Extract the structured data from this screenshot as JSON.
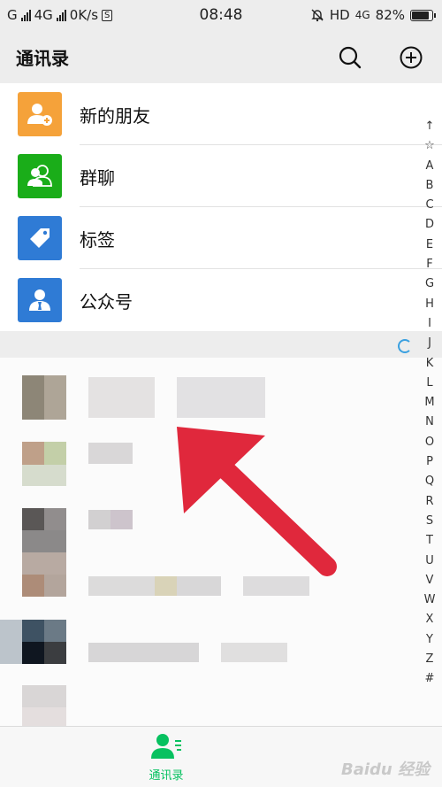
{
  "status_bar": {
    "left": "G",
    "network": "4G",
    "speed": "0K/s",
    "sim_box": "S",
    "time": "08:48",
    "hd": "HD",
    "network2": "4G",
    "battery": "82%"
  },
  "header": {
    "title": "通讯录"
  },
  "functions": [
    {
      "label": "新的朋友",
      "color": "#f5a23a",
      "icon": "add-friend-icon"
    },
    {
      "label": "群聊",
      "color": "#1aad19",
      "icon": "group-chat-icon"
    },
    {
      "label": "标签",
      "color": "#2f7bd5",
      "icon": "tag-icon"
    },
    {
      "label": "公众号",
      "color": "#2f7bd5",
      "icon": "official-account-icon"
    }
  ],
  "alphabet": [
    "↑",
    "☆",
    "A",
    "B",
    "C",
    "D",
    "E",
    "F",
    "G",
    "H",
    "I",
    "J",
    "K",
    "L",
    "M",
    "N",
    "O",
    "P",
    "Q",
    "R",
    "S",
    "T",
    "U",
    "V",
    "W",
    "X",
    "Y",
    "Z",
    "#"
  ],
  "tabbar": {
    "contacts_label": "通讯录",
    "watermark": "Baidu 经验"
  },
  "colors": {
    "accent": "#07c160",
    "arrow": "#e0283c"
  }
}
